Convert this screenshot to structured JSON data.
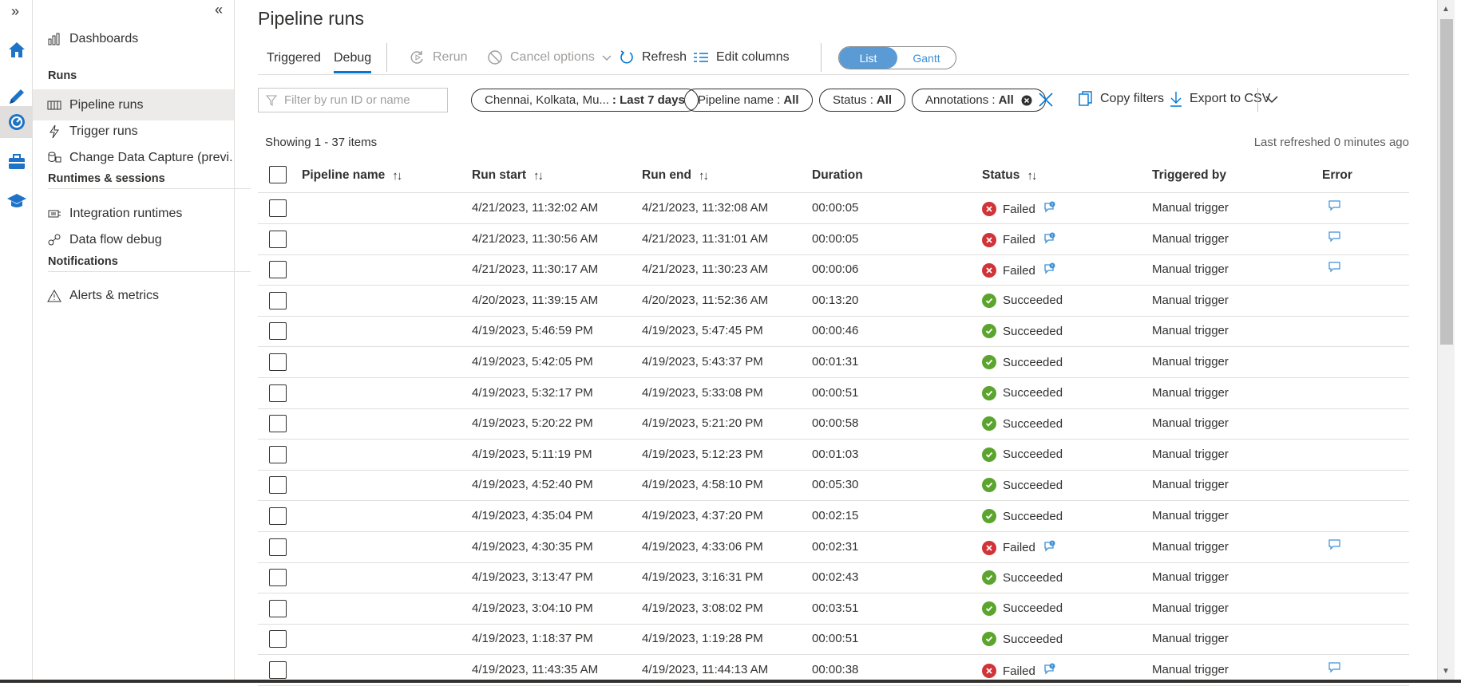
{
  "rail": {
    "expand_glyph": "»",
    "icons": [
      "home-icon",
      "author-pencil-icon",
      "monitor-icon",
      "manage-toolbox-icon",
      "learning-center-icon"
    ]
  },
  "nav": {
    "collapse_glyph": "«",
    "dashboards": "Dashboards",
    "runs_header": "Runs",
    "pipeline_runs": "Pipeline runs",
    "trigger_runs": "Trigger runs",
    "change_data_capture": "Change Data Capture (previ...",
    "runtimes_header": "Runtimes & sessions",
    "integration_runtimes": "Integration runtimes",
    "data_flow_debug": "Data flow debug",
    "notifications_header": "Notifications",
    "alerts_metrics": "Alerts & metrics"
  },
  "page": {
    "title": "Pipeline runs",
    "tabs": [
      "Triggered",
      "Debug"
    ],
    "active_tab": "Debug",
    "toolbar": {
      "rerun": "Rerun",
      "cancel_options": "Cancel options",
      "refresh": "Refresh",
      "edit_columns": "Edit columns"
    },
    "view_toggle": {
      "list": "List",
      "gantt": "Gantt",
      "selected": "List"
    },
    "filter_placeholder": "Filter by run ID or name",
    "filters": {
      "regions_label": "Chennai, Kolkata, Mu...",
      "regions_value": ": Last 7 days",
      "pipeline_label": "Pipeline name :",
      "pipeline_value": "All",
      "status_label": "Status :",
      "status_value": "All",
      "annotations_label": "Annotations :",
      "annotations_value": "All"
    },
    "copy_filters": "Copy filters",
    "export_csv": "Export to CSV",
    "showing": "Showing 1 - 37 items",
    "last_refreshed": "Last refreshed 0 minutes ago"
  },
  "colors": {
    "accent": "#0078d4",
    "failed": "#d13438",
    "succeeded": "#5ba52e",
    "toggle_on": "#5a9bd5"
  },
  "table": {
    "columns": [
      "Pipeline name",
      "Run start",
      "Run end",
      "Duration",
      "Status",
      "Triggered by",
      "Error"
    ],
    "rows": [
      {
        "name": "",
        "start": "4/21/2023, 11:32:02 AM",
        "end": "4/21/2023, 11:32:08 AM",
        "duration": "00:00:05",
        "status": "Failed",
        "trigger": "Manual trigger"
      },
      {
        "name": "",
        "start": "4/21/2023, 11:30:56 AM",
        "end": "4/21/2023, 11:31:01 AM",
        "duration": "00:00:05",
        "status": "Failed",
        "trigger": "Manual trigger"
      },
      {
        "name": "",
        "start": "4/21/2023, 11:30:17 AM",
        "end": "4/21/2023, 11:30:23 AM",
        "duration": "00:00:06",
        "status": "Failed",
        "trigger": "Manual trigger"
      },
      {
        "name": "",
        "start": "4/20/2023, 11:39:15 AM",
        "end": "4/20/2023, 11:52:36 AM",
        "duration": "00:13:20",
        "status": "Succeeded",
        "trigger": "Manual trigger"
      },
      {
        "name": "",
        "start": "4/19/2023, 5:46:59 PM",
        "end": "4/19/2023, 5:47:45 PM",
        "duration": "00:00:46",
        "status": "Succeeded",
        "trigger": "Manual trigger"
      },
      {
        "name": "",
        "start": "4/19/2023, 5:42:05 PM",
        "end": "4/19/2023, 5:43:37 PM",
        "duration": "00:01:31",
        "status": "Succeeded",
        "trigger": "Manual trigger"
      },
      {
        "name": "",
        "start": "4/19/2023, 5:32:17 PM",
        "end": "4/19/2023, 5:33:08 PM",
        "duration": "00:00:51",
        "status": "Succeeded",
        "trigger": "Manual trigger"
      },
      {
        "name": "",
        "start": "4/19/2023, 5:20:22 PM",
        "end": "4/19/2023, 5:21:20 PM",
        "duration": "00:00:58",
        "status": "Succeeded",
        "trigger": "Manual trigger"
      },
      {
        "name": "",
        "start": "4/19/2023, 5:11:19 PM",
        "end": "4/19/2023, 5:12:23 PM",
        "duration": "00:01:03",
        "status": "Succeeded",
        "trigger": "Manual trigger"
      },
      {
        "name": "",
        "start": "4/19/2023, 4:52:40 PM",
        "end": "4/19/2023, 4:58:10 PM",
        "duration": "00:05:30",
        "status": "Succeeded",
        "trigger": "Manual trigger"
      },
      {
        "name": "",
        "start": "4/19/2023, 4:35:04 PM",
        "end": "4/19/2023, 4:37:20 PM",
        "duration": "00:02:15",
        "status": "Succeeded",
        "trigger": "Manual trigger"
      },
      {
        "name": "",
        "start": "4/19/2023, 4:30:35 PM",
        "end": "4/19/2023, 4:33:06 PM",
        "duration": "00:02:31",
        "status": "Failed",
        "trigger": "Manual trigger"
      },
      {
        "name": "",
        "start": "4/19/2023, 3:13:47 PM",
        "end": "4/19/2023, 3:16:31 PM",
        "duration": "00:02:43",
        "status": "Succeeded",
        "trigger": "Manual trigger"
      },
      {
        "name": "",
        "start": "4/19/2023, 3:04:10 PM",
        "end": "4/19/2023, 3:08:02 PM",
        "duration": "00:03:51",
        "status": "Succeeded",
        "trigger": "Manual trigger"
      },
      {
        "name": "",
        "start": "4/19/2023, 1:18:37 PM",
        "end": "4/19/2023, 1:19:28 PM",
        "duration": "00:00:51",
        "status": "Succeeded",
        "trigger": "Manual trigger"
      },
      {
        "name": "",
        "start": "4/19/2023, 11:43:35 AM",
        "end": "4/19/2023, 11:44:13 AM",
        "duration": "00:00:38",
        "status": "Failed",
        "trigger": "Manual trigger"
      }
    ]
  }
}
